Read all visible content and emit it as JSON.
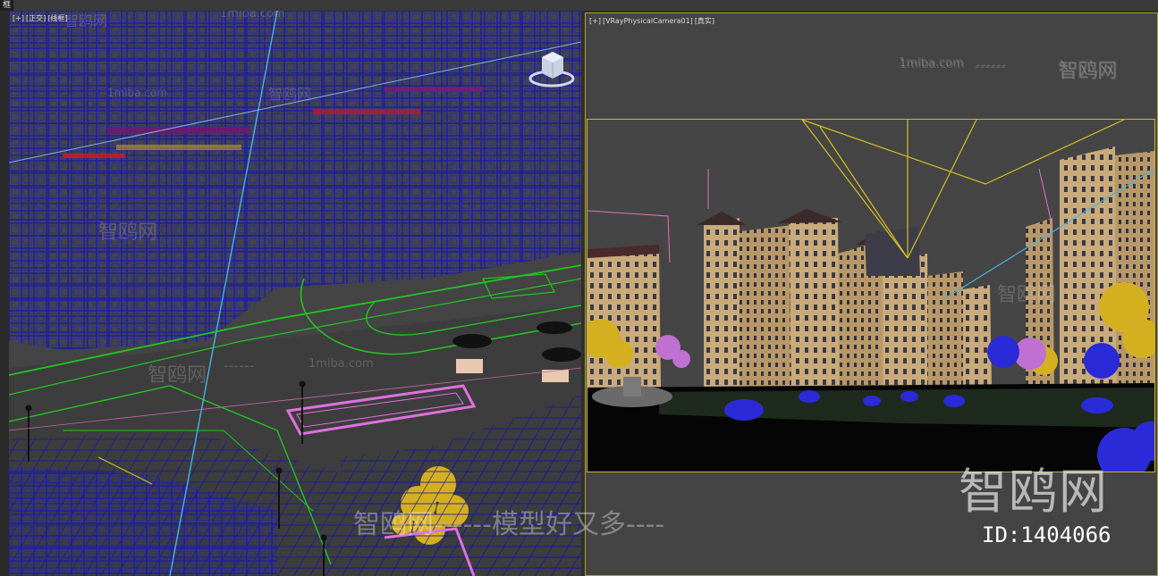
{
  "topbar": {
    "tab_label": "框"
  },
  "left_viewport": {
    "label_plus": "[+]",
    "label_view": "[正交]",
    "label_shading": "[线框]"
  },
  "right_viewport": {
    "label_plus": "[+]",
    "label_camera": "[VRayPhysicalCamera01]",
    "label_shading": "[真实]"
  },
  "watermarks": {
    "site": "1miba.com",
    "brand": "智鸥网",
    "dashes": "------",
    "big_brand": "智鸥网",
    "id_text": "ID:1404066",
    "bottom_text": "智鸥网------模型好又多----"
  },
  "colors": {
    "wireframe_blue": "#1a1aa8",
    "wire_green": "#22c422",
    "wire_pink": "#e070e0",
    "viewport_bg": "#444444",
    "frame_gold": "#c8b43a",
    "tree_yellow": "#d4b020",
    "shrub_blue": "#2a2ad8",
    "building_tan": "#c9aa7a"
  },
  "icons": {
    "viewcube": "viewcube-icon",
    "axis_gizmo": "axis-gizmo-icon"
  }
}
